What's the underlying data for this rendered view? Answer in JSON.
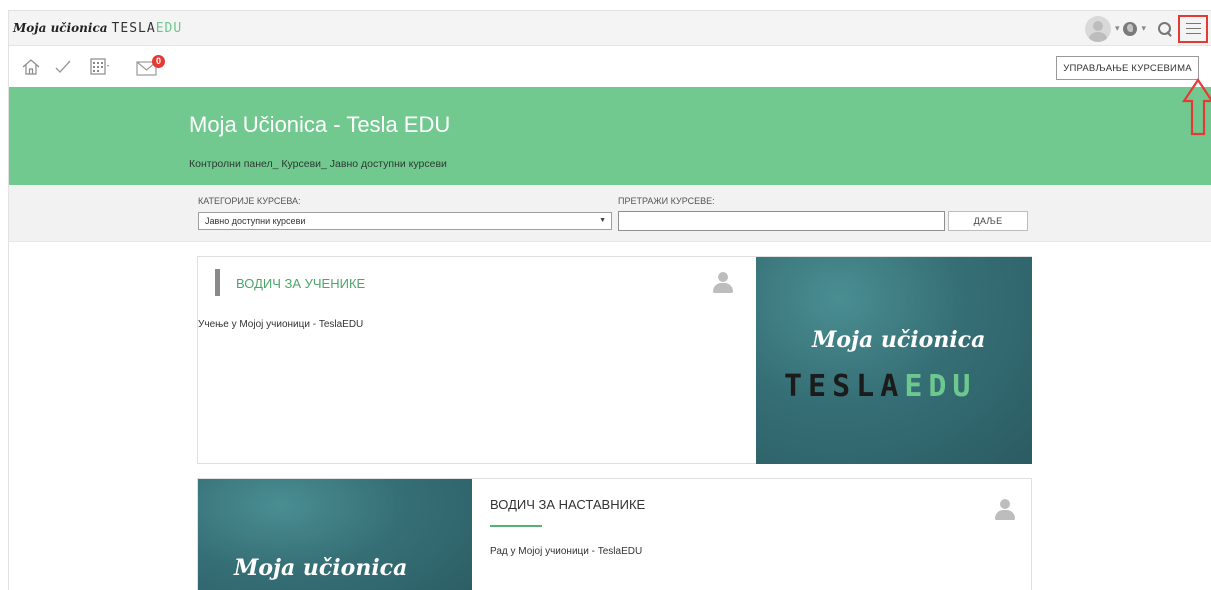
{
  "app": {
    "brand_script": "Moja učionica",
    "brand_tesla": "TESLA",
    "brand_edu": "EDU"
  },
  "topbar": {
    "user_caret": "▾",
    "globe_caret": "▾",
    "icons": [
      "avatar",
      "globe-icon",
      "search-icon",
      "hamburger-menu-icon"
    ]
  },
  "iconbar": {
    "messages_badge": "0",
    "icons": [
      "home-icon",
      "check-icon",
      "calendar-icon",
      "envelope-icon"
    ],
    "manage_courses_label": "УПРАВЉАЊЕ КУРСЕВИМА"
  },
  "hero": {
    "title": "Moja Učionica - Tesla EDU",
    "breadcrumb": "Контролни панел_ Курсеви_ Јавно доступни курсеви"
  },
  "filters": {
    "category_label": "КАТЕГОРИЈЕ КУРСЕВА:",
    "category_value": "Јавно доступни курсеви",
    "search_label": "ПРЕТРАЖИ КУРСЕВЕ:",
    "search_value": "",
    "go_label": "ДАЉЕ"
  },
  "courses": [
    {
      "title": "ВОДИЧ ЗА УЧЕНИКЕ",
      "description": "Учење у Мојој учионици -  TeslaEDU",
      "image_script": "Moja učionica",
      "image_tesla": "TESLA",
      "image_edu": "EDU"
    },
    {
      "title": "ВОДИЧ ЗА НАСТАВНИКЕ",
      "description": "Рад у Мојој учионици - TeslaEDU",
      "image_script": "Moja učionica"
    }
  ],
  "colors": {
    "hero_green": "#72c990",
    "accent_green": "#4ba66a",
    "badge_red": "#e53935",
    "highlight_red": "#e53935",
    "tile_teal": "#356f75"
  }
}
